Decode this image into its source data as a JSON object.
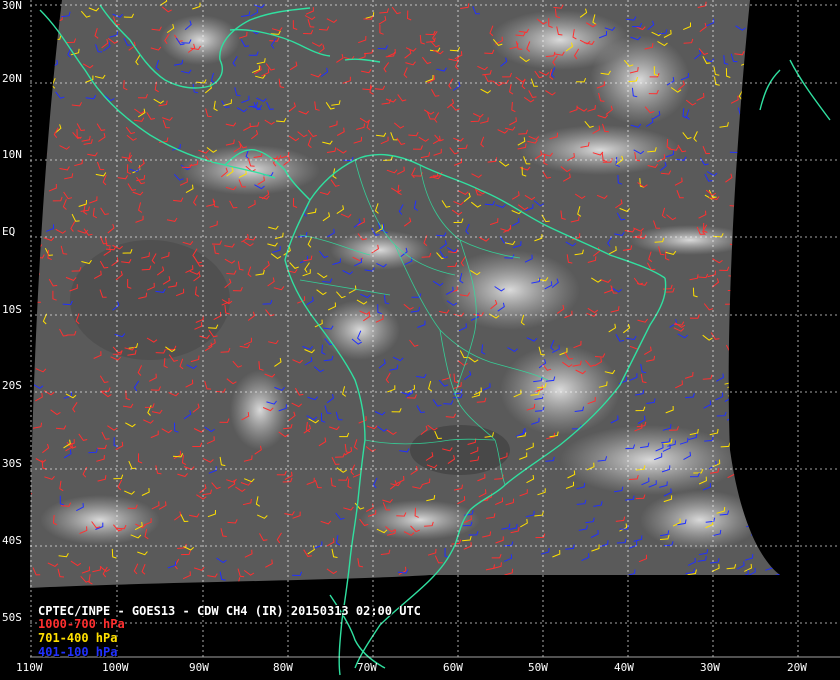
{
  "title": "CPTEC/INPE - GOES13 - CDW CH4 (IR) 20150313 02:00 UTC",
  "legend": [
    {
      "label": "1000-700 hPa",
      "color": "#ff3030"
    },
    {
      "label": "701-400 hPa",
      "color": "#ffe000"
    },
    {
      "label": "401-100 hPa",
      "color": "#2030ff"
    }
  ],
  "lat_labels": [
    "30N",
    "20N",
    "10N",
    "EQ",
    "10S",
    "20S",
    "30S",
    "40S",
    "50S"
  ],
  "lon_labels": [
    "110W",
    "100W",
    "90W",
    "80W",
    "70W",
    "60W",
    "50W",
    "40W",
    "30W",
    "20W"
  ],
  "colors": {
    "coastline": "#30e0a0",
    "grid": "#ffffff",
    "background": "#000000"
  }
}
